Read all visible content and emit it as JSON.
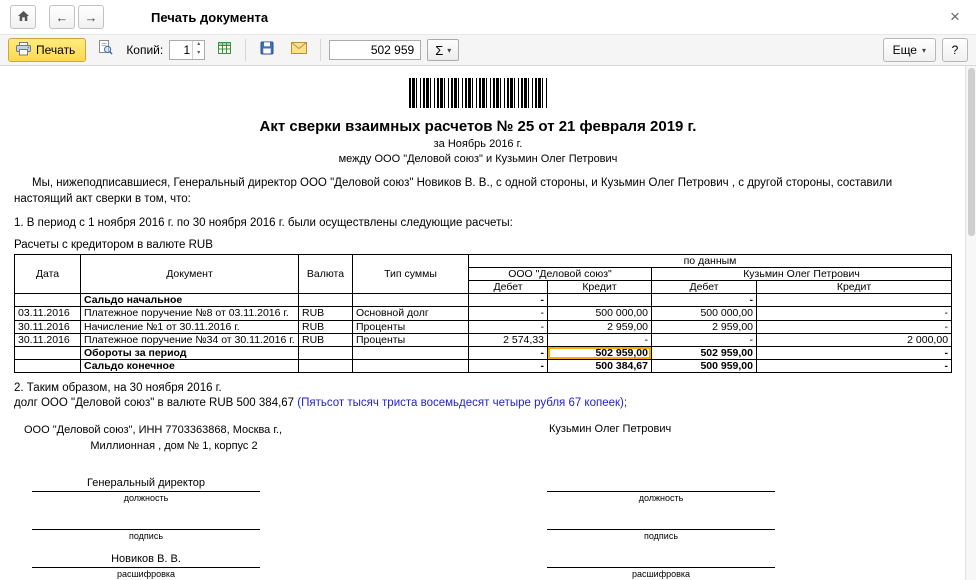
{
  "titlebar": {
    "title": "Печать документа"
  },
  "icons": {
    "back": "←",
    "forward": "→",
    "close": "×",
    "sigma": "Σ",
    "dropdown": "▾",
    "spinner_up": "▴",
    "spinner_down": "▾",
    "help": "?"
  },
  "toolbar": {
    "print_label": "Печать",
    "copies_label": "Копий:",
    "copies_value": "1",
    "sum_value": "502 959",
    "more_label": "Еще"
  },
  "doc": {
    "title": "Акт сверки взаимных расчетов № 25 от 21 февраля 2019 г.",
    "subtitle_period": "за Ноябрь 2016 г.",
    "subtitle_parties": "между ООО \"Деловой союз\" и Кузьмин Олег Петрович",
    "intro": "Мы, нижеподписавшиеся, Генеральный директор ООО \"Деловой союз\" Новиков В. В., с одной стороны, и Кузьмин Олег Петрович , с другой стороны, составили настоящий акт сверки в том, что:",
    "clause1": "1. В период с 1 ноября 2016 г. по 30 ноября 2016 г. были осуществлены следующие расчеты:",
    "table_caption": "Расчеты с кредитором в валюте RUB",
    "clause2_line1": "2. Таким образом, на 30 ноября 2016 г.",
    "clause2_amount": "долг ООО \"Деловой союз\" в валюте RUB 500 384,67",
    "clause2_words": "(Пятьсот тысяч триста восемьдесят четыре рубля 67 копеек);",
    "org_left_line1": "ООО \"Деловой союз\", ИНН 7703363868, Москва г.,",
    "org_left_line2": "Миллионная , дом № 1, корпус 2",
    "org_right": "Кузьмин Олег Петрович",
    "signatures": {
      "left_position": "Генеральный директор",
      "left_name": "Новиков В. В.",
      "label_position": "должность",
      "label_sign": "подпись",
      "label_name": "расшифровка"
    }
  },
  "table": {
    "group_header": "по данным",
    "org1": "ООО \"Деловой союз\"",
    "org2": "Кузьмин Олег Петрович",
    "col_date": "Дата",
    "col_doc": "Документ",
    "col_currency": "Валюта",
    "col_type": "Тип суммы",
    "col_debit": "Дебет",
    "col_credit": "Кредит",
    "highlight_color": "#ffaa00",
    "rows": [
      {
        "date": "",
        "doc": "Сальдо начальное",
        "cur": "",
        "type": "",
        "d1": "-",
        "c1": "",
        "d2": "-",
        "c2": ""
      },
      {
        "date": "03.11.2016",
        "doc": "Платежное поручение №8 от 03.11.2016 г.",
        "cur": "RUB",
        "type": "Основной долг",
        "d1": "-",
        "c1": "500 000,00",
        "d2": "500 000,00",
        "c2": "-"
      },
      {
        "date": "30.11.2016",
        "doc": "Начисление №1 от 30.11.2016 г.",
        "cur": "RUB",
        "type": "Проценты",
        "d1": "-",
        "c1": "2 959,00",
        "d2": "2 959,00",
        "c2": "-"
      },
      {
        "date": "30.11.2016",
        "doc": "Платежное поручение №34 от 30.11.2016 г.",
        "cur": "RUB",
        "type": "Проценты",
        "d1": "2 574,33",
        "c1": "-",
        "d2": "-",
        "c2": "2 000,00"
      },
      {
        "date": "",
        "doc": "Обороты за период",
        "cur": "",
        "type": "",
        "d1": "-",
        "c1": "502 959,00",
        "d2": "502 959,00",
        "c2": "-"
      },
      {
        "date": "",
        "doc": "Сальдо конечное",
        "cur": "",
        "type": "",
        "d1": "-",
        "c1": "500 384,67",
        "d2": "500 959,00",
        "c2": "-"
      }
    ]
  }
}
